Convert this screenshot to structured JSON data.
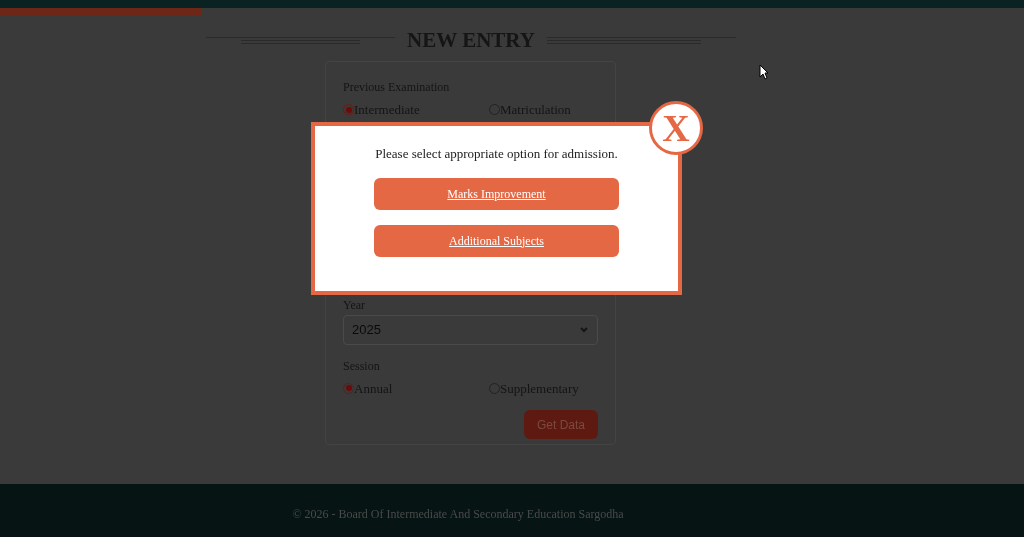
{
  "title": "NEW ENTRY",
  "form": {
    "previous_examination": {
      "label": "Previous Examination",
      "options": [
        {
          "label": "Intermediate",
          "selected": true
        },
        {
          "label": "Matriculation",
          "selected": false
        }
      ]
    },
    "year": {
      "label": "Year",
      "value": "2025"
    },
    "session": {
      "label": "Session",
      "options": [
        {
          "label": "Annual",
          "selected": true
        },
        {
          "label": "Supplementary",
          "selected": false
        }
      ]
    },
    "submit": "Get Data"
  },
  "modal": {
    "message": "Please select appropriate option for admission.",
    "buttons": [
      "Marks Improvement",
      "Additional Subjects"
    ],
    "close": "X"
  },
  "footer": "© 2026 - Board Of Intermediate And Secondary Education Sargodha"
}
